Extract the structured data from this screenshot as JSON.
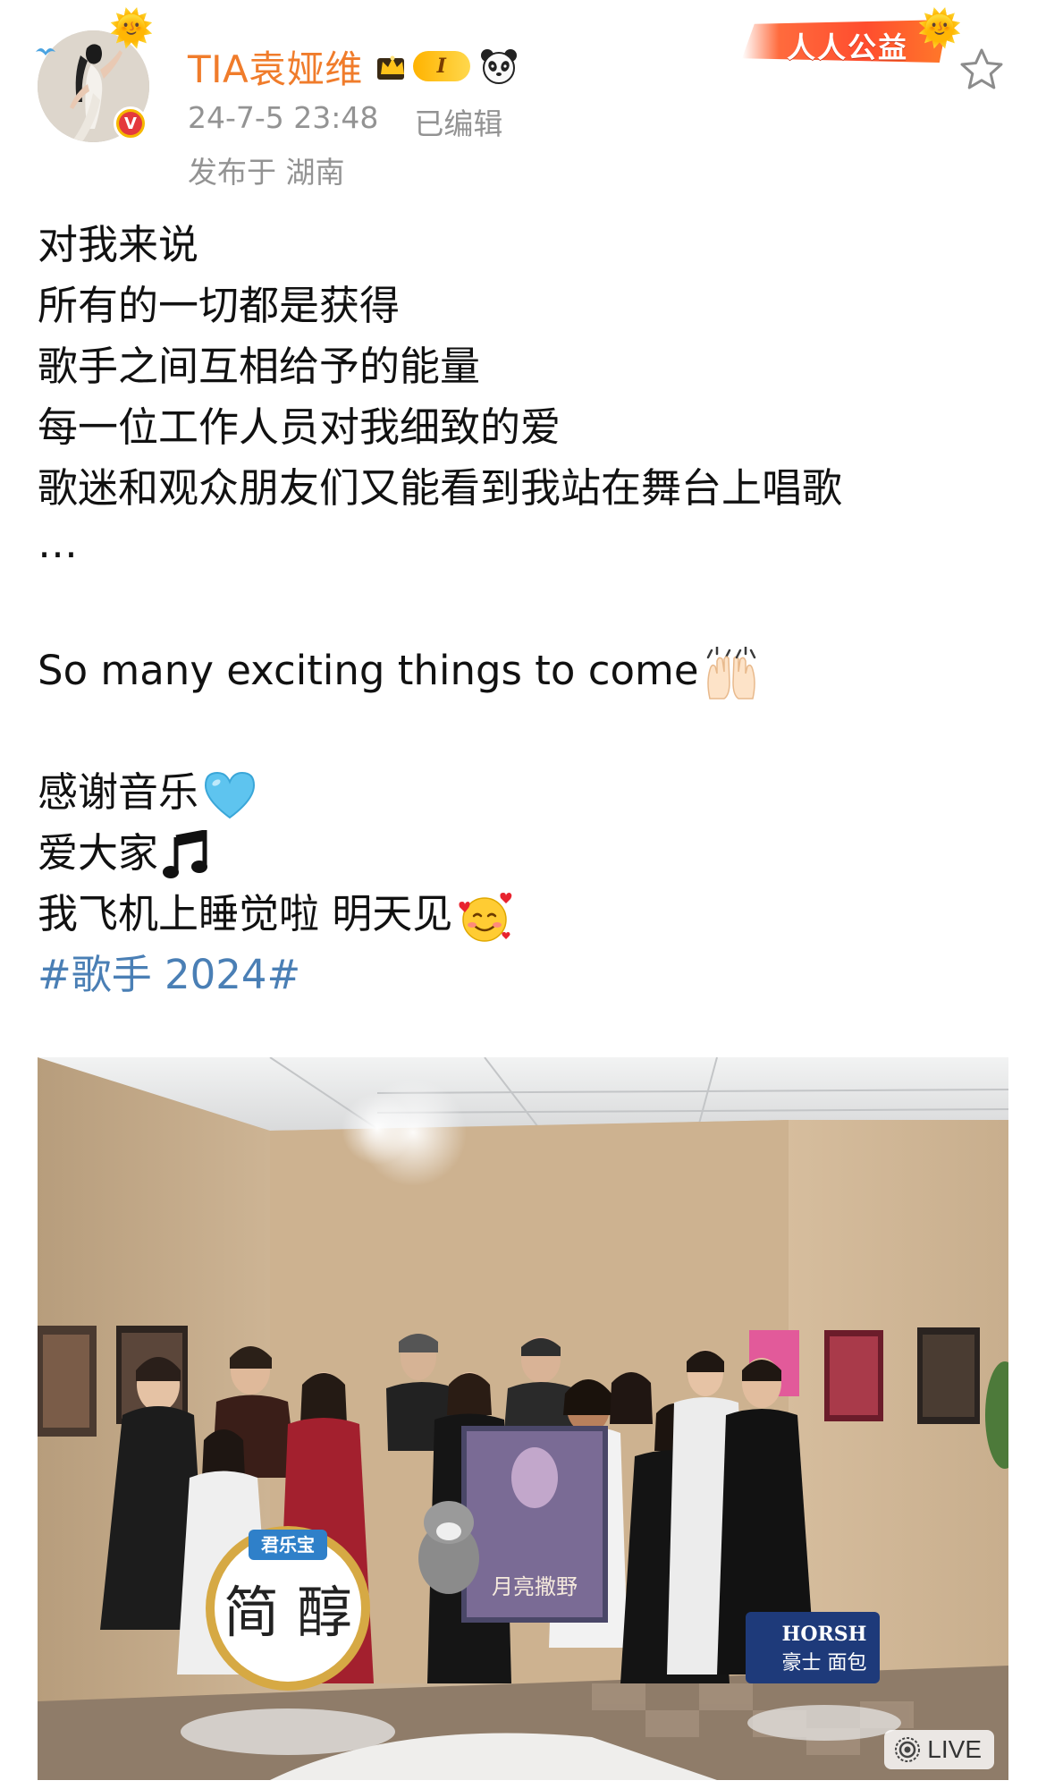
{
  "post": {
    "author": {
      "name": "TIA袁娅维",
      "level_badge": "I",
      "verified_mark": "V",
      "avatar_icon": "avatar-portrait-icon"
    },
    "charity_badge": "人人公益",
    "timestamp": "24-7-5 23:48",
    "edited_label": "已编辑",
    "location": "发布于 湖南",
    "body": {
      "line1": "对我来说",
      "line2": "所有的一切都是获得",
      "line3": "歌手之间互相给予的能量",
      "line4": "每一位工作人员对我细致的爱",
      "line5": "歌迷和观众朋友们又能看到我站在舞台上唱歌",
      "line6": "…",
      "line7": "So many exciting things to come",
      "line8": "感谢音乐",
      "line9": "爱大家",
      "line10": "我飞机上睡觉啦 明天见",
      "hashtag": "#歌手 2024#"
    },
    "photo": {
      "live_label": "LIVE",
      "signs": {
        "left_brand": "君乐宝",
        "left_main": "简 醇",
        "right_brand": "HORSH",
        "right_main": "豪士 面包"
      },
      "poster_text": "月亮撒野"
    }
  },
  "colors": {
    "username": "#f07c2b",
    "meta_gray": "#939393",
    "hashtag_blue": "#4a7fb5",
    "charity_red": "#ff4d2e"
  },
  "icons": [
    "sun-icon",
    "crown-icon",
    "panda-icon",
    "star-icon",
    "raised-hands-icon",
    "blue-heart-icon",
    "music-note-icon",
    "smiling-hearts-icon",
    "live-icon"
  ]
}
